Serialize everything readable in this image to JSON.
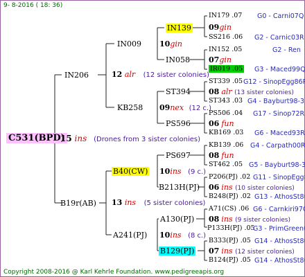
{
  "header": "9- 8-2016 ( 18: 36)",
  "footer": "Copyright 2008-2016 @ Karl Kehrle Foundation.   www.pedigreeapis.org",
  "root": {
    "code": "C531(BPD)",
    "num": "15",
    "ins": "ins",
    "desc": "(Drones from 3 sister colonies)"
  },
  "g1": {
    "top": {
      "code": "IN206",
      "num": "12",
      "ins": "alr",
      "desc": "(12 sister colonies)"
    },
    "bot": {
      "code": "B19r(AB)",
      "num": "13",
      "ins": "ins",
      "desc": "(5 sister colonies)"
    }
  },
  "g2": {
    "in009": {
      "code": "IN009",
      "num": "10",
      "ins": "gin"
    },
    "kb258": {
      "code": "KB258",
      "num": "09",
      "ins": "nex",
      "desc": "(12 c.)"
    },
    "b40": {
      "code": "B40(CW)",
      "num": "10",
      "ins": "ins",
      "desc": "(9 c.)"
    },
    "a241": {
      "code": "A241(PJ)",
      "num": "10",
      "ins": "ins",
      "desc": "(8 c.)"
    }
  },
  "g3": {
    "in139": "IN139",
    "in058": {
      "code": "IN058",
      "num": "07",
      "ins": "gin"
    },
    "st394": {
      "code": "ST394",
      "num": "08",
      "ins": "alr",
      "desc": "(13 sister colonies)"
    },
    "ps596": {
      "code": "PS596",
      "num": "06",
      "ins": "fun"
    },
    "ps697": {
      "code": "PS697",
      "num": "08",
      "ins": "fun"
    },
    "b213": {
      "code": "B213H(PJ)",
      "num": "06",
      "ins": "ins",
      "desc": "(10 sister colonies)"
    },
    "a130": {
      "code": "A130(PJ)",
      "num": "08",
      "ins": "ins",
      "desc": "(9 sister colonies)"
    },
    "b129": {
      "code": "B129(PJ)",
      "num": "07",
      "ins": "ins",
      "desc": "(12 sister colonies)"
    }
  },
  "g4": {
    "r1": {
      "left": "IN179 .07",
      "right": "G0 - Carni07Q"
    },
    "r1num": {
      "num": "09",
      "ins": "gin"
    },
    "r2": {
      "left": "SS216 .06",
      "right": "G2 - Carnic03R"
    },
    "r3": {
      "left": "IN152 .05",
      "right": "G2 - Ren"
    },
    "r4": {
      "left": "IR019 .05",
      "right": "G3 - Maced99Q"
    },
    "r5": {
      "left": "ST339 .05",
      "right": "G12 - SinopEgg86R"
    },
    "r6": {
      "left": "ST343 .03",
      "right": "G4 - Bayburt98-3"
    },
    "r7": {
      "left": "PS506 .04",
      "right": "G17 - Sinop72R"
    },
    "r8": {
      "left": "KB169 .03",
      "right": "G6 - Maced93R"
    },
    "r9": {
      "left": "KB139 .06",
      "right": "G4 - Carpath00R"
    },
    "r10": {
      "left": "ST462 .05",
      "right": "G5 - Bayburt98-3"
    },
    "r11": {
      "left": "P206(PJ) .02",
      "right": "G11 - SinopEgg86R"
    },
    "r12": {
      "left": "B248(PJ) .02",
      "right": "G13 - AthosSt80R"
    },
    "r13": {
      "left": "A71(CS) .06",
      "right": "G6 - Carnkiri97Q"
    },
    "r14": {
      "left": "P133H(PJ) .05",
      "right": "G3 - PrimGreen00"
    },
    "r15": {
      "left": "B333(PJ) .05",
      "right": "G14 - AthosSt80R"
    },
    "r16": {
      "left": "B124(PJ) .05",
      "right": "G14 - AthosSt80R"
    }
  },
  "colors": {
    "lines": "#222222",
    "insect": "#d40000",
    "desc": "#4a1aa0",
    "highlight_yellow": "#ffff00",
    "highlight_green": "#00cc00",
    "highlight_cyan": "#00ffff",
    "root_bg": "#ffc0ff"
  }
}
